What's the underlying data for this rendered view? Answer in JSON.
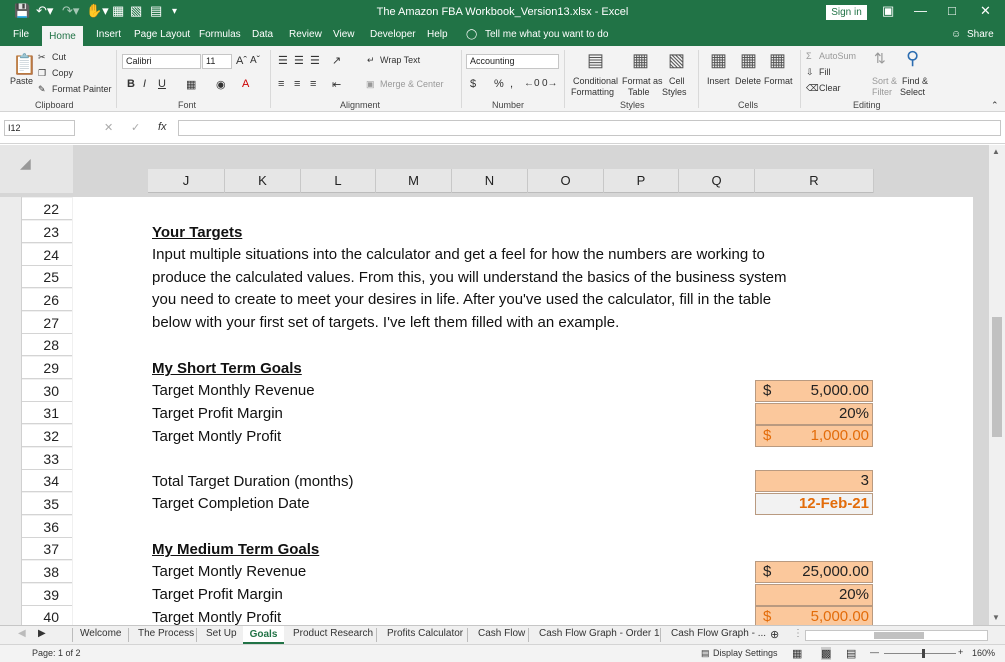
{
  "window": {
    "title": "The Amazon FBA Workbook_Version13.xlsx  -  Excel",
    "signin": "Sign in"
  },
  "tabs": [
    "File",
    "Home",
    "Insert",
    "Page Layout",
    "Formulas",
    "Data",
    "Review",
    "View",
    "Developer",
    "Help"
  ],
  "tell_me": "Tell me what you want to do",
  "share": "Share",
  "ribbon": {
    "clipboard": {
      "paste": "Paste",
      "cut": "Cut",
      "copy": "Copy",
      "format_painter": "Format Painter",
      "group": "Clipboard"
    },
    "font": {
      "name": "Calibri",
      "size": "11",
      "group": "Font",
      "bold": "B",
      "italic": "I",
      "underline": "U"
    },
    "alignment": {
      "wrap": "Wrap Text",
      "merge": "Merge & Center",
      "group": "Alignment"
    },
    "number": {
      "format": "Accounting",
      "group": "Number",
      "currency": "$",
      "percent": "%"
    },
    "styles": {
      "conditional": "Conditional",
      "conditional2": "Formatting",
      "format_as": "Format as",
      "format_as2": "Table",
      "cell": "Cell",
      "cell2": "Styles",
      "group": "Styles"
    },
    "cells": {
      "insert": "Insert",
      "delete": "Delete",
      "format": "Format",
      "group": "Cells"
    },
    "editing": {
      "autosum": "AutoSum",
      "fill": "Fill",
      "clear": "Clear",
      "sort": "Sort &",
      "sort2": "Filter",
      "find": "Find &",
      "find2": "Select",
      "group": "Editing"
    }
  },
  "namebox": "I12",
  "columns": [
    "J",
    "K",
    "L",
    "M",
    "N",
    "O",
    "P",
    "Q",
    "R"
  ],
  "rows": [
    "22",
    "23",
    "24",
    "25",
    "26",
    "27",
    "28",
    "29",
    "30",
    "31",
    "32",
    "33",
    "34",
    "35",
    "36",
    "37",
    "38",
    "39",
    "40"
  ],
  "content": {
    "heading_targets": "Your Targets",
    "p1": "Input multiple situations into the calculator and get a feel for how the numbers are working to",
    "p2": "produce the calculated values. From this, you will understand the basics of the business system",
    "p3": "you need to create to meet your desires in life. After you've used the calculator, fill in the table",
    "p4": "below with your first set of targets. I've left them filled with an example.",
    "short_heading": "My Short Term Goals",
    "short_rev_label": "Target Monthly Revenue",
    "short_margin_label": "Target Profit Margin",
    "short_profit_label": "Target Montly Profit",
    "duration_label": "Total Target Duration (months)",
    "completion_label": "Target Completion Date",
    "medium_heading": "My Medium Term Goals",
    "medium_rev_label": "Target Montly Revenue",
    "medium_margin_label": "Target Profit Margin",
    "medium_profit_label": "Target Montly Profit",
    "dollar": "$",
    "short_rev_val": "5,000.00",
    "short_margin_val": "20%",
    "short_profit_val": "1,000.00",
    "duration_val": "3",
    "completion_val": "12-Feb-21",
    "medium_rev_val": "25,000.00",
    "medium_margin_val": "20%",
    "medium_profit_val": "5,000.00"
  },
  "sheet_tabs": [
    "Welcome",
    "The Process",
    "Set Up",
    "Goals",
    "Product Research",
    "Profits Calculator",
    "Cash Flow",
    "Cash Flow Graph - Order 1",
    "Cash Flow Graph - ..."
  ],
  "status": {
    "page": "Page: 1 of 2",
    "display": "Display Settings",
    "zoom": "160%"
  },
  "colors": {
    "excel_green": "#217346",
    "cell_fill": "#fbc89c",
    "orange_text": "#e36c0a"
  }
}
